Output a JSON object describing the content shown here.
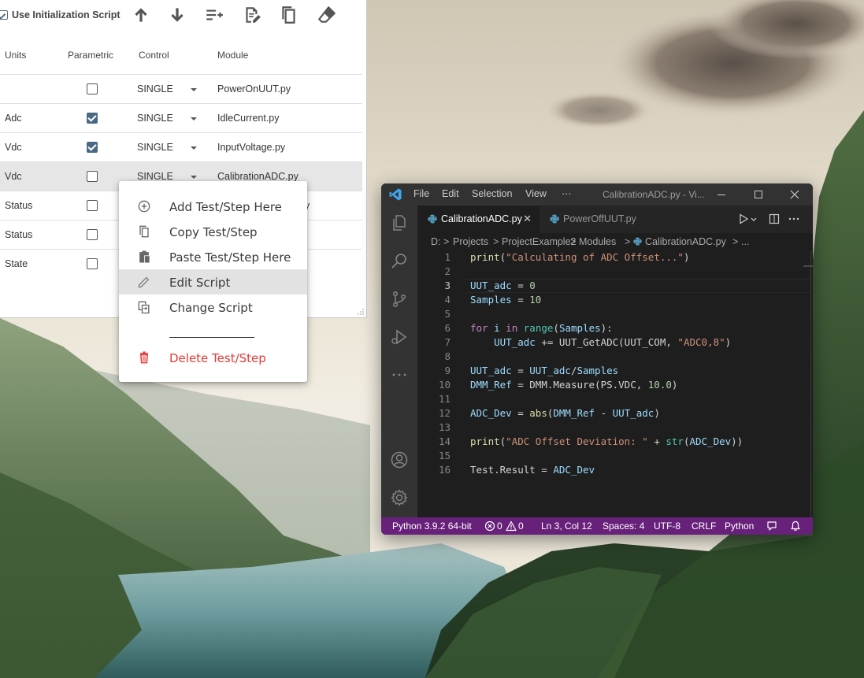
{
  "sequencer": {
    "toolbar": {
      "init_checked": true,
      "init_label": "Use Initialization Script",
      "icons": [
        "move-up-icon",
        "move-down-icon",
        "add-to-list-icon",
        "edit-document-icon",
        "copy-icon",
        "eraser-icon"
      ]
    },
    "columns": {
      "units": "Units",
      "parametric": "Parametric",
      "control": "Control",
      "module": "Module"
    },
    "rows": [
      {
        "units": "",
        "parametric": false,
        "control": "SINGLE",
        "module": "PowerOnUUT.py",
        "selected": false
      },
      {
        "units": "Adc",
        "parametric": true,
        "control": "SINGLE",
        "module": "IdleCurrent.py",
        "selected": false
      },
      {
        "units": "Vdc",
        "parametric": true,
        "control": "SINGLE",
        "module": "InputVoltage.py",
        "selected": false
      },
      {
        "units": "Vdc",
        "parametric": false,
        "control": "SINGLE",
        "module": "CalibrationADC.py",
        "selected": true
      },
      {
        "units": "Status",
        "parametric": false,
        "control": "",
        "module": "M.py",
        "selected": false
      },
      {
        "units": "Status",
        "parametric": false,
        "control": "",
        "module": "",
        "selected": false
      },
      {
        "units": "State",
        "parametric": false,
        "control": "",
        "module": "",
        "selected": false
      }
    ]
  },
  "context_menu": {
    "items": [
      {
        "label": "Add Test/Step Here",
        "icon": "add-circle-icon",
        "highlighted": false,
        "danger": false
      },
      {
        "label": "Copy Test/Step",
        "icon": "copy-icon",
        "highlighted": false,
        "danger": false
      },
      {
        "label": "Paste Test/Step Here",
        "icon": "paste-icon",
        "highlighted": false,
        "danger": false
      },
      {
        "label": "Edit Script",
        "icon": "pencil-icon",
        "highlighted": true,
        "danger": false
      },
      {
        "label": "Change Script",
        "icon": "change-script-icon",
        "highlighted": false,
        "danger": false
      },
      {
        "label": "Delete Test/Step",
        "icon": "trash-icon",
        "highlighted": false,
        "danger": true
      }
    ],
    "danger_color": "#e53935"
  },
  "vscode": {
    "menu": [
      "File",
      "Edit",
      "Selection",
      "View",
      "···"
    ],
    "window_title": "CalibrationADC.py - Vi...",
    "tabs": [
      {
        "label": "CalibrationADC.py",
        "active": true,
        "close": "✕"
      },
      {
        "label": "PowerOffUUT.py",
        "active": false,
        "close": ""
      }
    ],
    "breadcrumb": [
      "D:",
      "Projects",
      "ProjectExample2",
      "Modules",
      "CalibrationADC.py",
      "..."
    ],
    "breadcrumb_sep": ">",
    "current_line": 3,
    "code": [
      [
        [
          "fn",
          "print"
        ],
        [
          "p",
          "("
        ],
        [
          "str",
          "\"Calculating of ADC Offset...\""
        ],
        [
          "p",
          ")"
        ]
      ],
      [],
      [
        [
          "var",
          "UUT_adc"
        ],
        [
          "p",
          " = "
        ],
        [
          "num",
          "0"
        ]
      ],
      [
        [
          "var",
          "Samples"
        ],
        [
          "p",
          " = "
        ],
        [
          "num",
          "10"
        ]
      ],
      [],
      [
        [
          "kw",
          "for"
        ],
        [
          "p",
          " "
        ],
        [
          "var",
          "i"
        ],
        [
          "p",
          " "
        ],
        [
          "kw",
          "in"
        ],
        [
          "p",
          " "
        ],
        [
          "bi",
          "range"
        ],
        [
          "p",
          "("
        ],
        [
          "var",
          "Samples"
        ],
        [
          "p",
          "):"
        ]
      ],
      [
        [
          "p",
          "    "
        ],
        [
          "var",
          "UUT_adc"
        ],
        [
          "p",
          " += UUT_GetADC(UUT_COM, "
        ],
        [
          "str",
          "\"ADC0,8\""
        ],
        [
          "p",
          ")"
        ]
      ],
      [],
      [
        [
          "var",
          "UUT_adc"
        ],
        [
          "p",
          " = "
        ],
        [
          "var",
          "UUT_adc"
        ],
        [
          "p",
          "/"
        ],
        [
          "var",
          "Samples"
        ]
      ],
      [
        [
          "var",
          "DMM_Ref"
        ],
        [
          "p",
          " = DMM.Measure(PS.VDC, "
        ],
        [
          "num",
          "10.0"
        ],
        [
          "p",
          ")"
        ]
      ],
      [],
      [
        [
          "var",
          "ADC_Dev"
        ],
        [
          "p",
          " = "
        ],
        [
          "fn",
          "abs"
        ],
        [
          "p",
          "("
        ],
        [
          "var",
          "DMM_Ref"
        ],
        [
          "p",
          " - "
        ],
        [
          "var",
          "UUT_adc"
        ],
        [
          "p",
          ")"
        ]
      ],
      [],
      [
        [
          "fn",
          "print"
        ],
        [
          "p",
          "("
        ],
        [
          "str",
          "\"ADC Offset Deviation: \""
        ],
        [
          "p",
          " + "
        ],
        [
          "bi",
          "str"
        ],
        [
          "p",
          "("
        ],
        [
          "var",
          "ADC_Dev"
        ],
        [
          "p",
          "))"
        ]
      ],
      [],
      [
        [
          "p",
          "Test.Result = "
        ],
        [
          "var",
          "ADC_Dev"
        ]
      ]
    ],
    "status": {
      "interpreter": "Python 3.9.2 64-bit",
      "errors": "0",
      "warnings": "0",
      "position": "Ln 3, Col 12",
      "spaces": "Spaces: 4",
      "encoding": "UTF-8",
      "eol": "CRLF",
      "language": "Python"
    },
    "status_color": "#68217a"
  }
}
